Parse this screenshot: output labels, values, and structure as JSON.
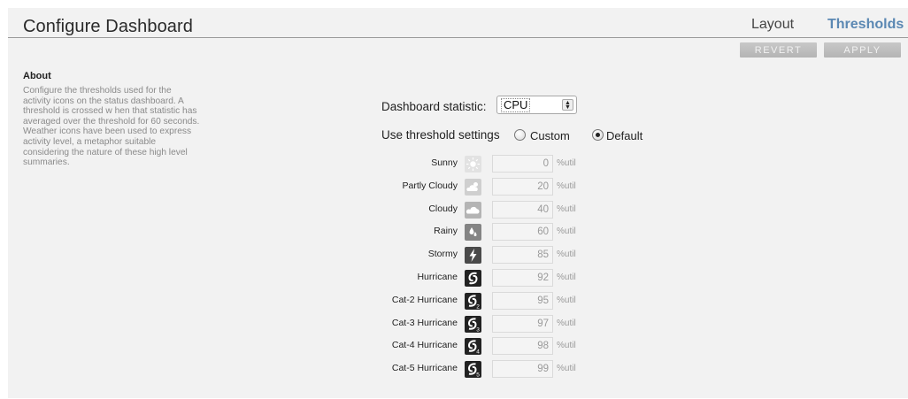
{
  "header": {
    "title": "Configure Dashboard",
    "tabs": [
      "Layout",
      "Thresholds"
    ],
    "active_tab": "Thresholds",
    "revert_label": "REVERT",
    "apply_label": "APPLY"
  },
  "about": {
    "heading": "About",
    "text": "Configure the thresholds used for the activity icons on the status dashboard. A threshold is crossed w hen that statistic has averaged over the threshold for 60 seconds. Weather icons have been used to express activity level, a metaphor suitable considering the nature of these high level summaries."
  },
  "settings": {
    "statistic_label": "Dashboard statistic:",
    "statistic_value": "CPU",
    "use_label": "Use threshold settings",
    "custom_label": "Custom",
    "default_label": "Default",
    "selected": "Default"
  },
  "colors": {
    "accent": "#5b88b3",
    "button": "#bdbdbd"
  },
  "thresholds": [
    {
      "label": "Sunny",
      "value": "0",
      "unit": "%util",
      "icon": "sunny-icon",
      "icon_bg": "#e2e2e2"
    },
    {
      "label": "Partly Cloudy",
      "value": "20",
      "unit": "%util",
      "icon": "partly-cloudy-icon",
      "icon_bg": "#cfcfcf"
    },
    {
      "label": "Cloudy",
      "value": "40",
      "unit": "%util",
      "icon": "cloudy-icon",
      "icon_bg": "#b4b4b4"
    },
    {
      "label": "Rainy",
      "value": "60",
      "unit": "%util",
      "icon": "rainy-icon",
      "icon_bg": "#848484"
    },
    {
      "label": "Stormy",
      "value": "85",
      "unit": "%util",
      "icon": "stormy-icon",
      "icon_bg": "#4a4a4a"
    },
    {
      "label": "Hurricane",
      "value": "92",
      "unit": "%util",
      "icon": "hurricane-icon",
      "icon_bg": "#222222"
    },
    {
      "label": "Cat-2 Hurricane",
      "value": "95",
      "unit": "%util",
      "icon": "cat-2-hurricane-icon",
      "icon_bg": "#222222"
    },
    {
      "label": "Cat-3 Hurricane",
      "value": "97",
      "unit": "%util",
      "icon": "cat-3-hurricane-icon",
      "icon_bg": "#222222"
    },
    {
      "label": "Cat-4 Hurricane",
      "value": "98",
      "unit": "%util",
      "icon": "cat-4-hurricane-icon",
      "icon_bg": "#222222"
    },
    {
      "label": "Cat-5 Hurricane",
      "value": "99",
      "unit": "%util",
      "icon": "cat-5-hurricane-icon",
      "icon_bg": "#222222"
    }
  ]
}
